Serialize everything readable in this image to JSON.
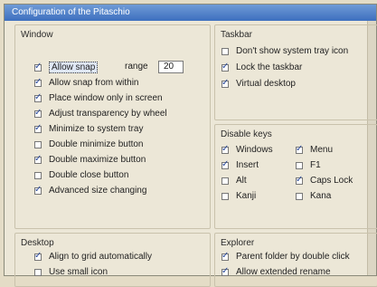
{
  "window": {
    "title": "Configuration of the Pitaschio"
  },
  "groups": {
    "window": {
      "title": "Window",
      "range_label": "range",
      "range_value": "20",
      "items": [
        {
          "label": "Allow snap",
          "checked": true
        },
        {
          "label": "Allow snap from within",
          "checked": true
        },
        {
          "label": "Place window only in screen",
          "checked": true
        },
        {
          "label": "Adjust transparency by wheel",
          "checked": true
        },
        {
          "label": "Minimize to system tray",
          "checked": true
        },
        {
          "label": "Double minimize button",
          "checked": false
        },
        {
          "label": "Double maximize button",
          "checked": true
        },
        {
          "label": "Double close button",
          "checked": false
        },
        {
          "label": "Advanced size changing",
          "checked": true
        }
      ]
    },
    "taskbar": {
      "title": "Taskbar",
      "items": [
        {
          "label": "Don't show system tray icon",
          "checked": false
        },
        {
          "label": "Lock the taskbar",
          "checked": true
        },
        {
          "label": "Virtual desktop",
          "checked": true
        }
      ]
    },
    "disable_keys": {
      "title": "Disable keys",
      "items": [
        {
          "label": "Windows",
          "checked": true
        },
        {
          "label": "Menu",
          "checked": true
        },
        {
          "label": "Insert",
          "checked": true
        },
        {
          "label": "F1",
          "checked": false
        },
        {
          "label": "Alt",
          "checked": false
        },
        {
          "label": "Caps Lock",
          "checked": true
        },
        {
          "label": "Kanji",
          "checked": false
        },
        {
          "label": "Kana",
          "checked": false
        }
      ]
    },
    "desktop": {
      "title": "Desktop",
      "items": [
        {
          "label": "Align to grid automatically",
          "checked": true
        },
        {
          "label": "Use small icon",
          "checked": false
        }
      ]
    },
    "explorer": {
      "title": "Explorer",
      "items": [
        {
          "label": "Parent folder by double click",
          "checked": true
        },
        {
          "label": "Allow extended rename",
          "checked": true
        }
      ]
    }
  }
}
